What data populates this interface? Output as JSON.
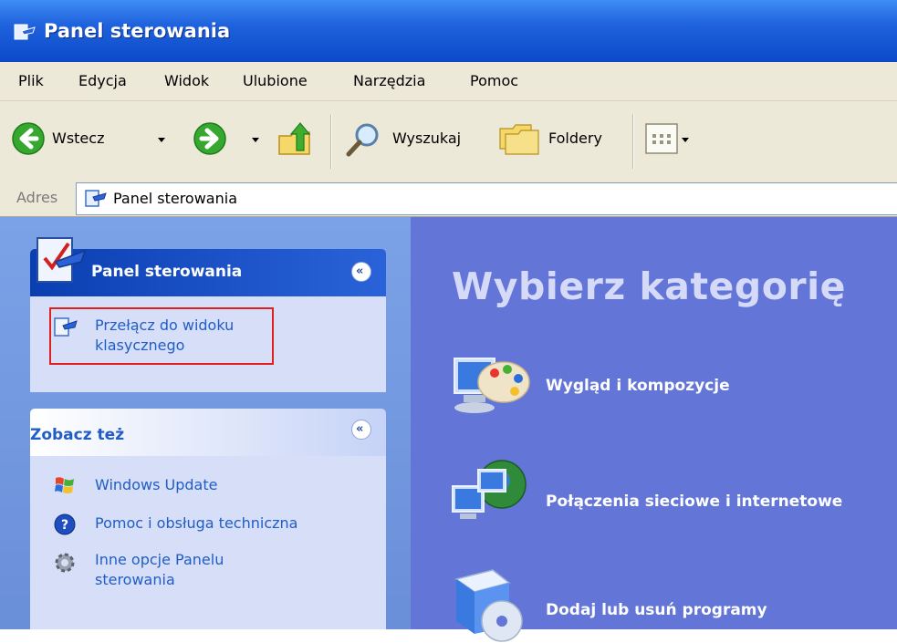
{
  "window": {
    "title": "Panel sterowania"
  },
  "menu": {
    "items": [
      "Plik",
      "Edycja",
      "Widok",
      "Ulubione",
      "Narzędzia",
      "Pomoc"
    ]
  },
  "toolbar": {
    "back_label": "Wstecz",
    "search_label": "Wyszukaj",
    "folders_label": "Foldery"
  },
  "address": {
    "label": "Adres",
    "value": "Panel sterowania"
  },
  "sidebar": {
    "panel1": {
      "title": "Panel sterowania",
      "link_line1": "Przełącz do widoku",
      "link_line2": "klasycznego"
    },
    "panel2": {
      "title": "Zobacz też",
      "items": [
        {
          "label": "Windows Update",
          "icon": "windows-update-icon"
        },
        {
          "label": "Pomoc i obsługa techniczna",
          "icon": "help-icon"
        },
        {
          "label_line1": "Inne opcje Panelu",
          "label_line2": "sterowania",
          "icon": "gear-icon"
        }
      ]
    }
  },
  "main": {
    "heading": "Wybierz kategorię",
    "categories": [
      {
        "label": "Wygląd i kompozycje",
        "icon": "appearance-icon"
      },
      {
        "label": "Połączenia sieciowe i internetowe",
        "icon": "network-icon"
      },
      {
        "label": "Dodaj lub usuń programy",
        "icon": "add-remove-programs-icon"
      }
    ]
  },
  "colors": {
    "title_bar": "#0b49c9",
    "chrome": "#ece9d8",
    "sidebar": "#7ba2e7",
    "main_background": "#6375d6",
    "link": "#215dc6",
    "highlight": "#e02020"
  }
}
